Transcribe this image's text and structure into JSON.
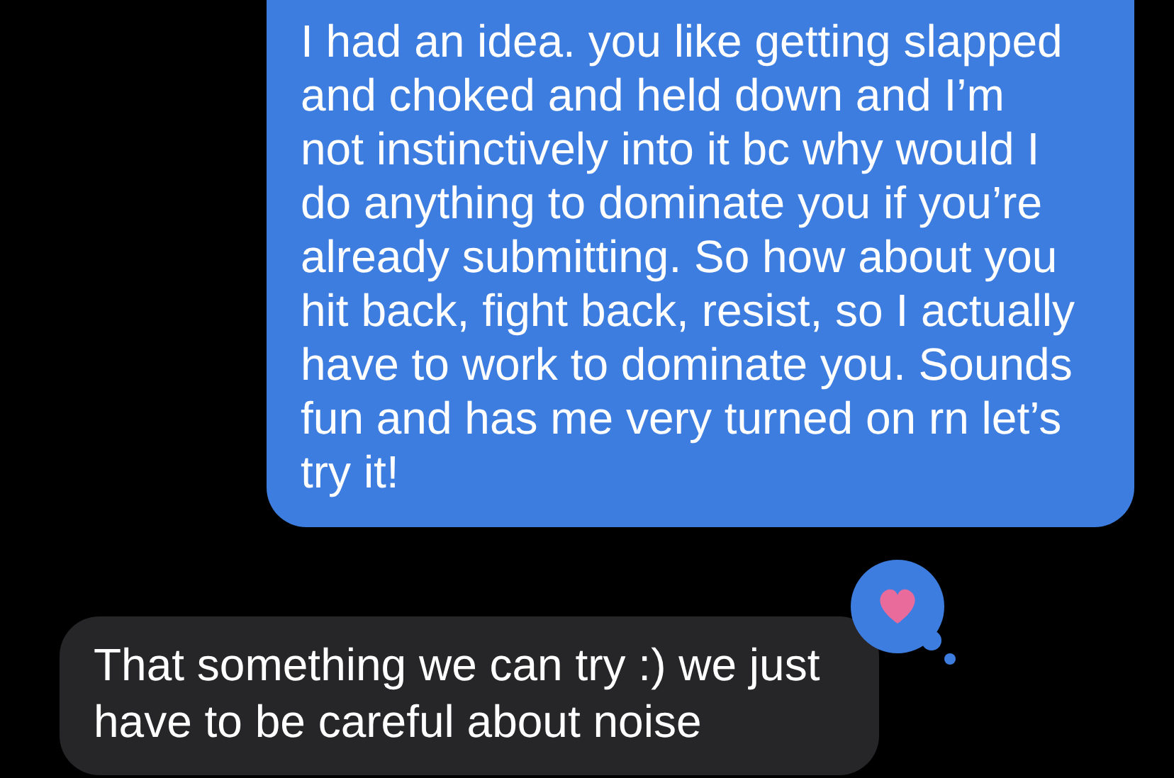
{
  "messages": [
    {
      "kind": "sent",
      "text": "I had an idea. you like getting slapped and choked and held down and I’m not instinctively into it bc why would I do anything to dominate you if you’re already submitting. So how about you hit back, fight back, resist, so I actually have to work to dominate you. Sounds fun and has me very turned on rn let’s try it!"
    },
    {
      "kind": "received",
      "text": "That something we can try :) we just have to be careful about noise",
      "hearted": true
    }
  ]
}
